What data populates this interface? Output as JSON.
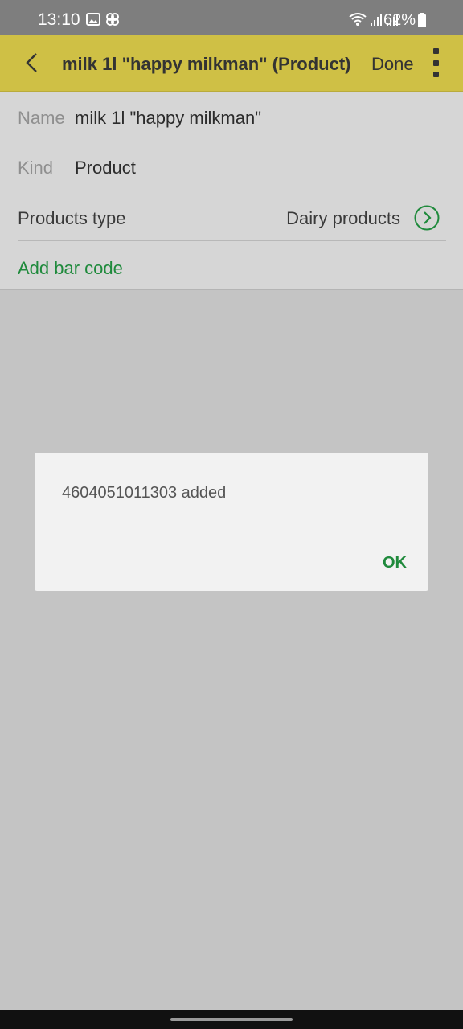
{
  "status_bar": {
    "time": "13:10",
    "battery": "62%",
    "icons": [
      "gallery-icon",
      "pinwheel-icon",
      "wifi-icon",
      "signal-icon",
      "signal-icon",
      "battery-icon"
    ]
  },
  "app_bar": {
    "title": "milk 1l \"happy milkman\" (Product)",
    "done_label": "Done",
    "icons": [
      "back-arrow-icon",
      "more-vert-icon"
    ],
    "color": "#cfc045"
  },
  "form": {
    "name_label": "Name",
    "name_value": "milk 1l \"happy milkman\"",
    "kind_label": "Kind",
    "kind_value": "Product",
    "products_type_label": "Products type",
    "products_type_value": "Dairy products",
    "add_barcode_label": "Add bar code"
  },
  "dialog": {
    "message": "4604051011303 added",
    "ok_label": "OK"
  },
  "colors": {
    "accent_green": "#1f8a3c",
    "scrim": "#c4c4c4"
  }
}
